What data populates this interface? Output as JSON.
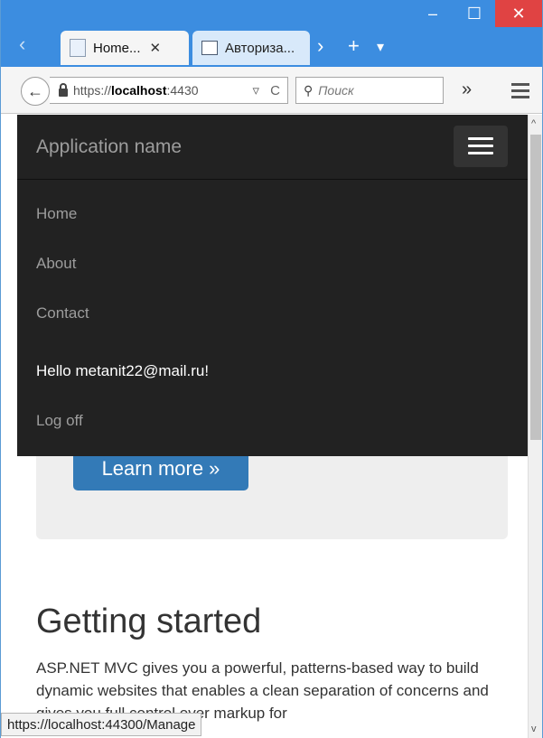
{
  "window": {
    "minimize_glyph": "–",
    "maximize_glyph": "☐",
    "close_glyph": "✕"
  },
  "tabs": [
    {
      "label": "Home...",
      "close": "✕"
    },
    {
      "label": "Авториза..."
    }
  ],
  "tab_controls": {
    "scroll_left": "‹",
    "scroll_right": "›",
    "new_tab": "+",
    "list": "▾"
  },
  "address_bar": {
    "prefix": "https://",
    "host": "localhost",
    "port": ":4430",
    "dropdown": "▿",
    "reload": "C"
  },
  "search": {
    "placeholder": "Поиск",
    "glyph": "🔍"
  },
  "toolbar": {
    "overflow": "»"
  },
  "navbar": {
    "brand": "Application name",
    "links": [
      "Home",
      "About",
      "Contact"
    ],
    "greeting": "Hello metanit22@mail.ru!",
    "logoff": "Log off"
  },
  "page": {
    "learn_more": "Learn more »",
    "heading": "Getting started",
    "paragraph": "ASP.NET MVC gives you a powerful, patterns-based way to build dynamic websites that enables a clean separation of concerns and gives you full control over markup for"
  },
  "status_bar": {
    "url": "https://localhost:44300/Manage"
  },
  "scrollbar": {
    "up": "^",
    "down": "v"
  }
}
